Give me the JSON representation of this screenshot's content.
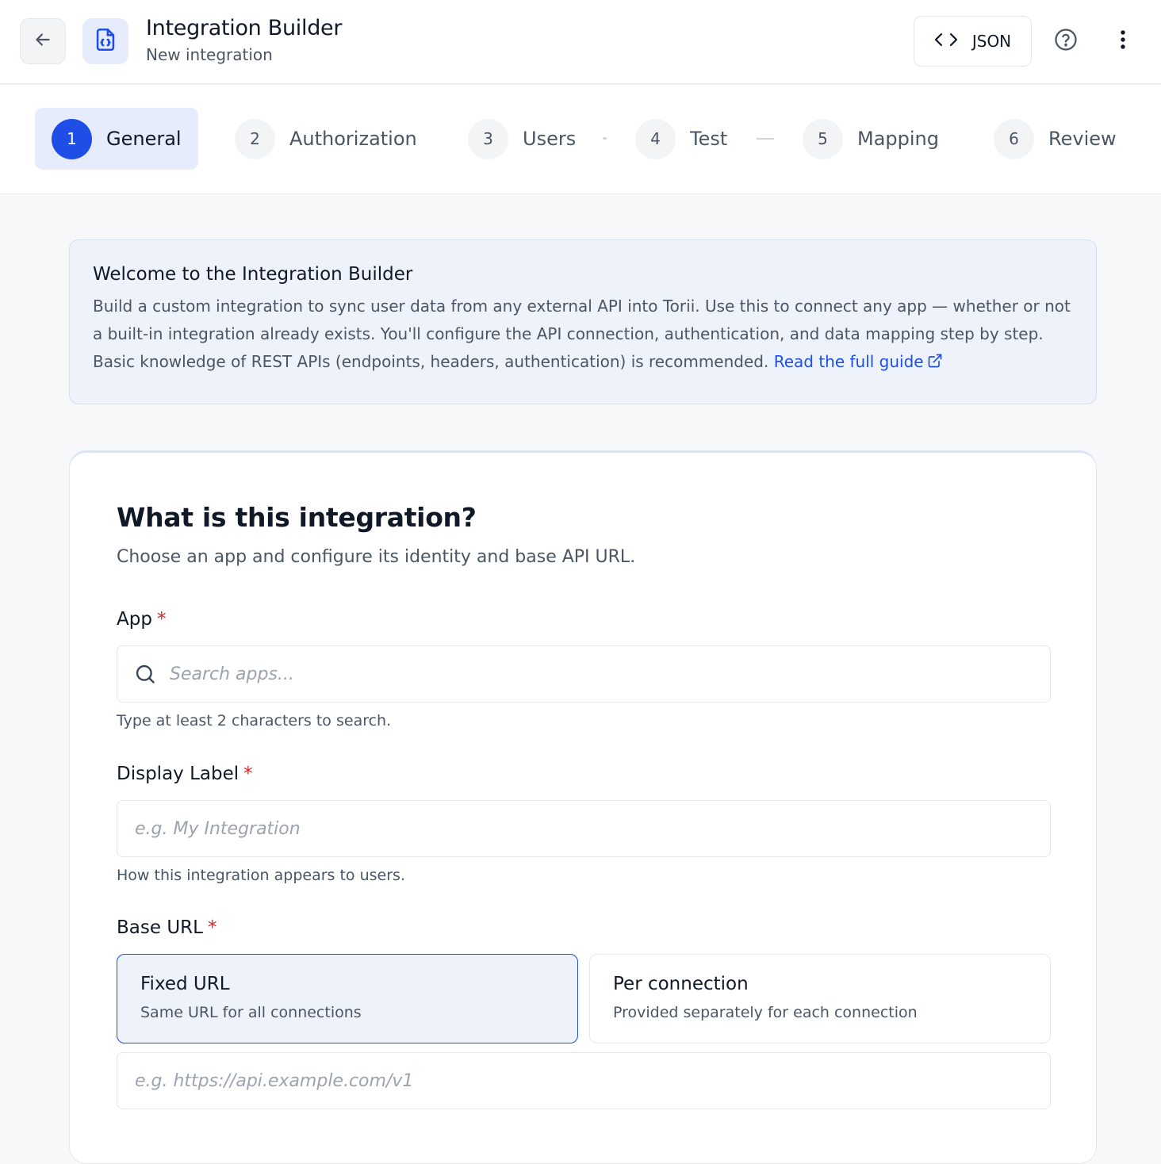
{
  "header": {
    "title": "Integration Builder",
    "subtitle": "New integration",
    "json_button_label": "JSON",
    "icons": {
      "back": "arrow-left-icon",
      "app": "code-file-icon",
      "json": "code-brackets-icon",
      "help": "help-circle-icon",
      "more": "more-vertical-icon"
    }
  },
  "steps": [
    {
      "number": "1",
      "label": "General",
      "active": true
    },
    {
      "number": "2",
      "label": "Authorization",
      "active": false
    },
    {
      "number": "3",
      "label": "Users",
      "active": false
    },
    {
      "number": "4",
      "label": "Test",
      "active": false
    },
    {
      "number": "5",
      "label": "Mapping",
      "active": false
    },
    {
      "number": "6",
      "label": "Review",
      "active": false
    }
  ],
  "welcome": {
    "title": "Welcome to the Integration Builder",
    "body": "Build a custom integration to sync user data from any external API into Torii. Use this to connect any app — whether or not a built-in integration already exists. You'll configure the API connection, authentication, and data mapping step by step. Basic knowledge of REST APIs (endpoints, headers, authentication) is recommended.",
    "link_label": "Read the full guide",
    "link_icon": "external-link-icon"
  },
  "form": {
    "title": "What is this integration?",
    "description": "Choose an app and configure its identity and base API URL.",
    "app": {
      "label": "App",
      "required_marker": "*",
      "placeholder": "Search apps...",
      "value": "",
      "hint": "Type at least 2 characters to search.",
      "icon": "search-icon"
    },
    "display_label": {
      "label": "Display Label",
      "required_marker": "*",
      "placeholder": "e.g. My Integration",
      "value": "",
      "hint": "How this integration appears to users."
    },
    "base_url": {
      "label": "Base URL",
      "required_marker": "*",
      "options": [
        {
          "title": "Fixed URL",
          "subtitle": "Same URL for all connections",
          "selected": true
        },
        {
          "title": "Per connection",
          "subtitle": "Provided separately for each connection",
          "selected": false
        }
      ],
      "placeholder": "e.g. https://api.example.com/v1",
      "value": ""
    }
  },
  "colors": {
    "accent": "#1e4ee6",
    "required": "#dc2626",
    "info_bg": "#eef2fb",
    "active_step_bg": "#e6ecfb"
  }
}
